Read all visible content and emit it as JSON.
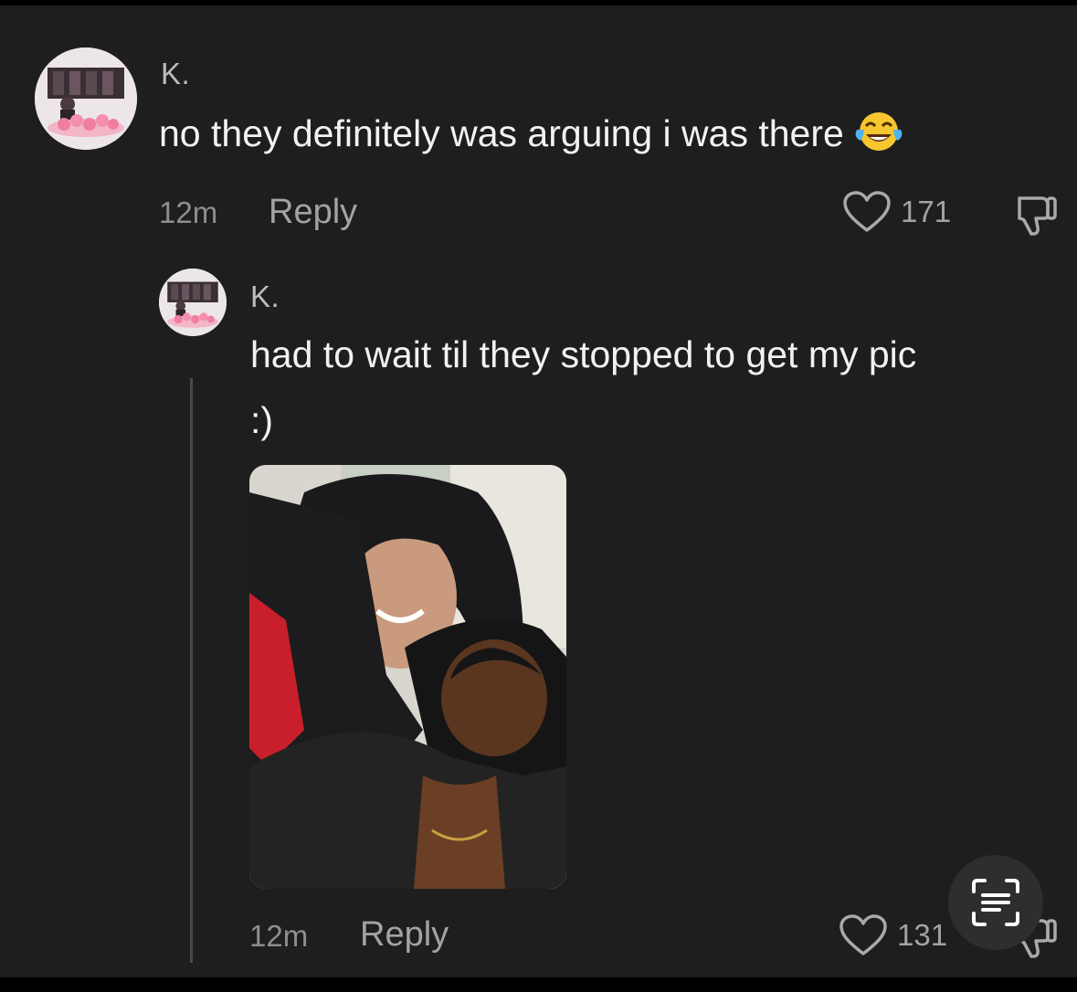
{
  "comments": [
    {
      "username": "K.",
      "text": "no they definitely was arguing i was there",
      "emoji": "face-with-tears-of-joy-icon",
      "time": "12m",
      "reply_label": "Reply",
      "likes": "171"
    },
    {
      "username": "K.",
      "text_line1": "had to wait til they stopped to get my pic",
      "text_line2": ":)",
      "time": "12m",
      "reply_label": "Reply",
      "likes": "131"
    }
  ],
  "colors": {
    "background": "#1e1e1e",
    "text": "#f2f2f2",
    "muted": "#8e8e8e",
    "thread_line": "#4a4a4a"
  },
  "icons": {
    "like": "heart-outline-icon",
    "dislike": "thumbs-down-icon",
    "scan": "live-text-scan-icon"
  }
}
